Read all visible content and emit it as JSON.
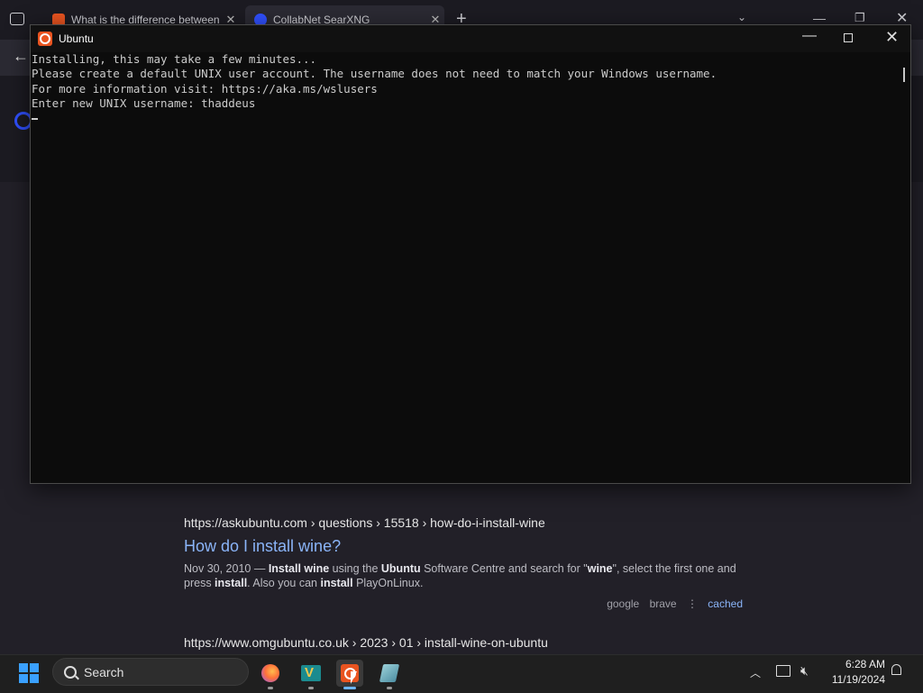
{
  "browser": {
    "tabs": [
      {
        "title": "What is the difference between",
        "favicon_color": "#e95420",
        "favicon_text": "ask"
      },
      {
        "title": "CollabNet SearXNG",
        "favicon_color": "#3050ff"
      }
    ],
    "new_tab_glyph": "+",
    "results": [
      {
        "url": "https://askubuntu.com  › questions › 15518 › how-do-i-install-wine",
        "title": "How do I install wine?",
        "snippet": [
          {
            "t": "Nov 30, 2010 — ",
            "b": false
          },
          {
            "t": "Install wine",
            "b": true
          },
          {
            "t": " using the ",
            "b": false
          },
          {
            "t": "Ubuntu",
            "b": true
          },
          {
            "t": " Software Centre and search for \"",
            "b": false
          },
          {
            "t": "wine",
            "b": true
          },
          {
            "t": "\", select the first one and press ",
            "b": false
          },
          {
            "t": "install",
            "b": true
          },
          {
            "t": ". Also you can ",
            "b": false
          },
          {
            "t": "install",
            "b": true
          },
          {
            "t": " PlayOnLinux.",
            "b": false
          }
        ],
        "engines": [
          "google",
          "brave"
        ],
        "separator": "⋮",
        "cached": "cached"
      },
      {
        "url": "https://www.omgubuntu.co.uk  › 2023 › 01 › install-wine-on-ubuntu"
      }
    ]
  },
  "console": {
    "title": "Ubuntu",
    "lines": [
      "Installing, this may take a few minutes...",
      "Please create a default UNIX user account. The username does not need to match your Windows username.",
      "For more information visit: https://aka.ms/wslusers",
      "Enter new UNIX username: thaddeus"
    ],
    "accent_color": "#e95420"
  },
  "taskbar": {
    "search_label": "Search",
    "apps": [
      "firefox-icon",
      "visual-studio-icon",
      "ubuntu-icon",
      "notepad-icon"
    ],
    "time": "6:28 AM",
    "date": "11/19/2024"
  }
}
